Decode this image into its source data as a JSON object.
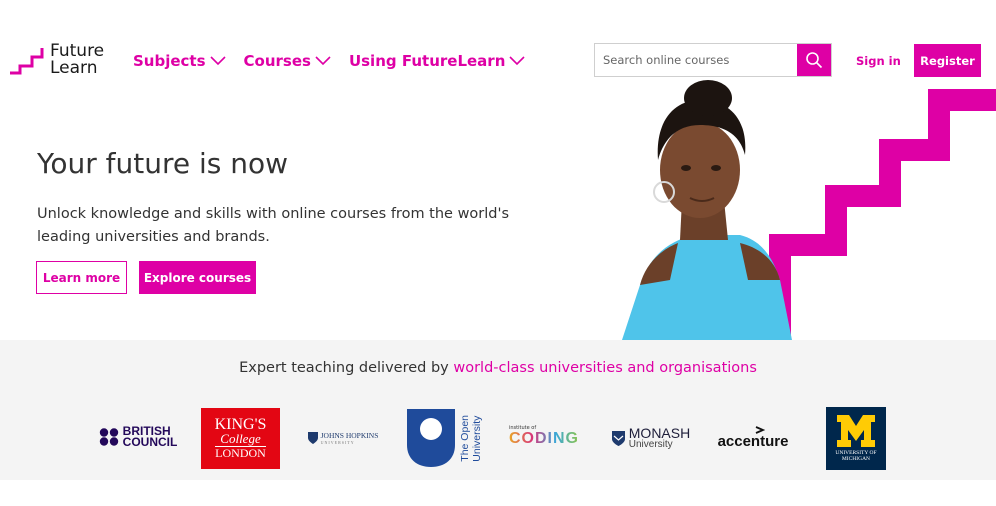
{
  "header": {
    "logo_line1": "Future",
    "logo_line2": "Learn",
    "nav": [
      {
        "label": "Subjects"
      },
      {
        "label": "Courses"
      },
      {
        "label": "Using FutureLearn"
      }
    ],
    "search": {
      "placeholder": "Search online courses"
    },
    "signin_label": "Sign in",
    "register_label": "Register"
  },
  "hero": {
    "title": "Your future is now",
    "subtitle": "Unlock knowledge and skills with online courses from the world's leading universities and brands.",
    "learn_more_label": "Learn more",
    "explore_label": "Explore courses"
  },
  "partners": {
    "text_prefix": "Expert teaching delivered by",
    "text_highlight": "world-class universities and organisations",
    "british_council": [
      "BRITISH",
      "COUNCIL"
    ],
    "kings": [
      "KING'S",
      "College",
      "LONDON"
    ],
    "johns_hopkins": [
      "JOHNS HOPKINS",
      "UNIVERSITY"
    ],
    "open_university": [
      "The Open",
      "University"
    ],
    "coding_small": "institute of",
    "coding": "CODING",
    "monash": [
      "MONASH",
      "University"
    ],
    "accenture": "accenture",
    "michigan": [
      "UNIVERSITY OF",
      "MICHIGAN"
    ]
  },
  "colors": {
    "accent": "#de00a5",
    "text": "#333333",
    "strip": "#f4f4f4"
  }
}
